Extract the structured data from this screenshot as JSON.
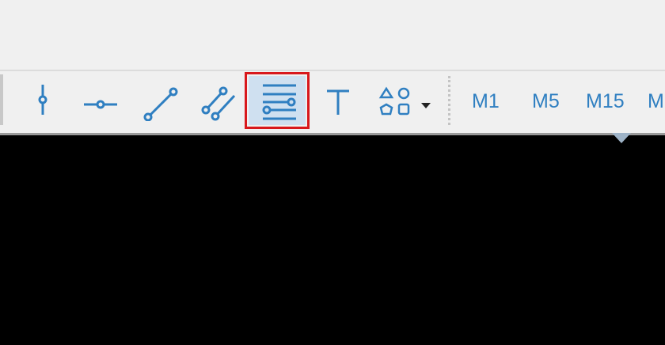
{
  "colors": {
    "icon_blue": "#2f7fc1",
    "selection_outline": "#d8181c",
    "selection_fill": "#cfe0f0",
    "chart_background": "#000000"
  },
  "toolbar": {
    "tools": [
      {
        "icon": "vertical-line-icon"
      },
      {
        "icon": "horizontal-line-icon"
      },
      {
        "icon": "trend-line-icon"
      },
      {
        "icon": "parallel-channel-icon"
      },
      {
        "icon": "fibonacci-retracement-icon",
        "selected": true
      },
      {
        "icon": "text-icon"
      },
      {
        "icon": "shapes-icon",
        "dropdown": true
      }
    ],
    "timeframes": [
      "M1",
      "M5",
      "M15",
      "M"
    ]
  }
}
